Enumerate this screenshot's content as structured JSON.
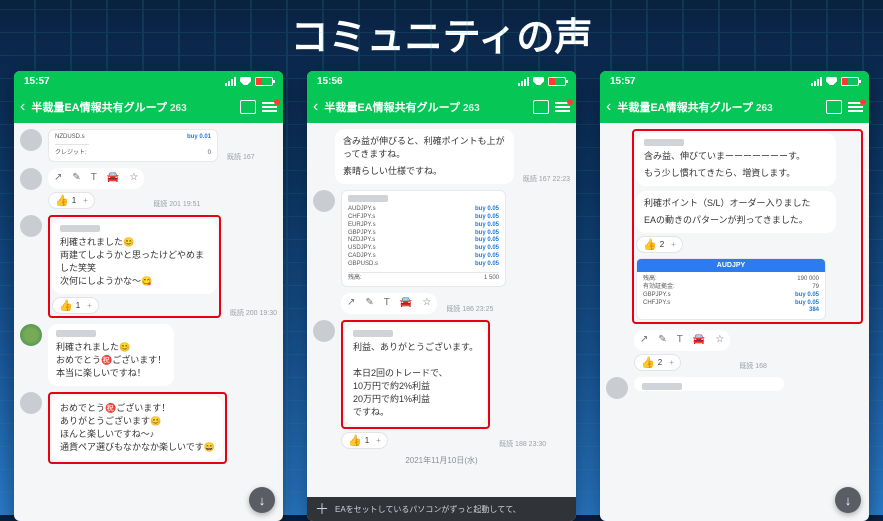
{
  "page_title": "コミュニティの声",
  "common": {
    "chat_name": "半裁量EA情報共有グループ",
    "chat_count": "263",
    "reaction_emoji": "👍",
    "plus": "+"
  },
  "phone1": {
    "time": "15:57",
    "trade_shot": {
      "pair": "NZDUSD.s",
      "side": "buy 0.01"
    },
    "meta0": "既読 167",
    "msgA": {
      "l1": "利確されました😊",
      "l2": "両建てしようかと思ったけどやめました笑笑",
      "l3": "次何にしようかな〜😋",
      "react": "1",
      "meta": "既読 200\n19:30"
    },
    "toolbar_meta": "既読 201\n19:51",
    "msgB": {
      "l1": "利確されました😊",
      "l2": "おめでとう㊗️ございます！",
      "l3": "本当に楽しいですね！"
    },
    "msgC": {
      "l1": "おめでとう㊗️ございます！",
      "l2": "ありがとうございます😊",
      "l3": "ほんと楽しいですね〜♪",
      "l4": "通貨ペア選びもなかなか楽しいです😄"
    }
  },
  "phone2": {
    "time": "15:56",
    "msgTop": {
      "l1": "含み益が伸びると、利確ポイントも上がってきますね。",
      "l2": "素晴らしい仕様ですね。",
      "meta": "既読 167\n22:23"
    },
    "shot_pairs": [
      "AUDJPY.s",
      "CHFJPY.s",
      "EURJPY.s",
      "GBPJPY.s",
      "NZDJPY.s",
      "USDJPY.s",
      "CADJPY.s",
      "GBPUSD.s"
    ],
    "shot_side": "buy 0.05",
    "toolbar_meta": "既読 186\n23:25",
    "msgMain": {
      "l1": "利益、ありがとうございます。",
      "l2": "本日2回のトレードで、",
      "l3": "10万円で約2%利益",
      "l4": "20万円で約1%利益",
      "l5": "ですね。",
      "react": "1",
      "meta": "既読 188\n23:30"
    },
    "date": "2021年11月10日(水)",
    "input_hint": "EAをセットしているパソコンがずっと起動してて、"
  },
  "phone3": {
    "time": "15:57",
    "msgA": {
      "l1": "含み益、伸びていまーーーーーーーす。",
      "l2": "もう少し慣れてきたら、増資します。"
    },
    "msgB": {
      "l1": "利確ポイント（S/L）オーダー入りました",
      "l2": "EAの動きのパターンが判ってきました。",
      "react": "2"
    },
    "shot_header": "AUDJPY",
    "shot_pairs": [
      "GBPJPY.s",
      "CHFJPY.s"
    ],
    "shot_side": "buy 0.05",
    "num1": "190 000",
    "num2": "79",
    "num3": "384",
    "toolbar_meta": "既読 168",
    "react_bottom": "2"
  }
}
